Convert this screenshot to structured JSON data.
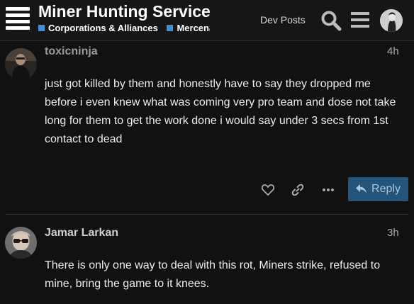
{
  "header": {
    "title": "Miner Hunting Service",
    "categories": [
      {
        "label": "Corporations & Alliances",
        "color": "#3f8fd8"
      },
      {
        "label": "Mercenaries",
        "color": "#3f8fd8"
      }
    ],
    "dev_posts_label": "Dev Posts",
    "icons": {
      "logo": "hamburger-logo-icon",
      "search": "search-icon",
      "menu": "menu-icon",
      "avatar": "user-avatar"
    }
  },
  "posts": [
    {
      "username": "toxicninja",
      "time": "4h",
      "body": "just got killed by them and honestly have to say they dropped me before i even knew what was coming very pro team and dose not take long for them to get the work done i would say under 3 secs from 1st contact to dead",
      "actions": {
        "like": "heart-icon",
        "share": "link-icon",
        "more": "ellipsis-icon",
        "reply_label": "Reply"
      }
    },
    {
      "username": "Jamar Larkan",
      "time": "3h",
      "body": "There is only one way to deal with this rot, Miners strike, refused to mine, bring the game to it knees."
    }
  ],
  "colors": {
    "background": "#111111",
    "header": "#161616",
    "category": "#3f8fd8",
    "reply_button": "#24547a"
  }
}
